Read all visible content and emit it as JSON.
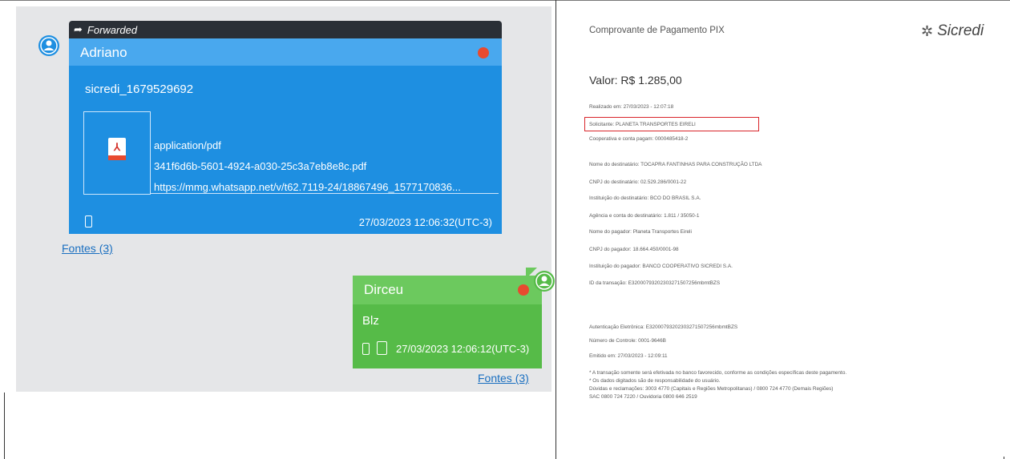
{
  "chat": {
    "forwarded_label": "Forwarded",
    "incoming": {
      "sender": "Adriano",
      "text": "sicredi_1679529692",
      "attachment": {
        "mime": "application/pdf",
        "filename": "341f6d6b-5601-4924-a030-25c3a7eb8e8c.pdf",
        "url": "https://mmg.whatsapp.net/v/t62.7119-24/18867496_1577170836..."
      },
      "timestamp": "27/03/2023 12:06:32(UTC-3)",
      "sources_link": "Fontes (3)"
    },
    "outgoing": {
      "sender": "Dirceu",
      "text": "Blz",
      "timestamp": "27/03/2023 12:06:12(UTC-3)",
      "sources_link": "Fontes (3)"
    }
  },
  "receipt": {
    "title": "Comprovante de Pagamento PIX",
    "brand": "Sicredi",
    "amount": "Valor: R$ 1.285,00",
    "lines": [
      "Realizado em: 27/03/2023 - 12:07:18",
      "Solicitante: PLANETA TRANSPORTES EIRELI",
      "Cooperativa e conta pagam: 0000485418-2",
      "Nome do destinatário: TOCAPRA FANTINHAS PARA CONSTRUÇÃO LTDA",
      "CNPJ do destinatário: 02.529.286/0001-22",
      "Instituição do destinatário: BCO DO BRASIL S.A.",
      "Agência e conta do destinatário: 1.811 / 35050-1",
      "Nome do pagador: Planeta Transportes Eireli",
      "CNPJ do pagador: 18.664.450/0001-98",
      "Instituição do pagador: BANCO COOPERATIVO SICREDI S.A.",
      "ID da transação: E32000793202303271507256mbmtBZS",
      "Autenticação Eletrônica: E32000793202303271507256mbmtBZS",
      "Número de Controle: 0001-9646B",
      "Emitido em: 27/03/2023 - 12:09:11",
      "* A transação somente será efetivada no banco favorecido, conforme as condições específicas deste pagamento.",
      "* Os dados digitados são de responsabilidade do usuário.",
      "Dúvidas e reclamações: 3003 4770 (Capitais e Regiões Metropolitanas) / 0800 724 4770 (Demais Regiões)",
      "SAC 0800 724 7220 / Ouvidoria 0800 646 2519"
    ]
  },
  "colors": {
    "incoming_bubble": "#1e8fe1",
    "outgoing_bubble": "#56bb48",
    "highlight_border": "#d9252a"
  }
}
